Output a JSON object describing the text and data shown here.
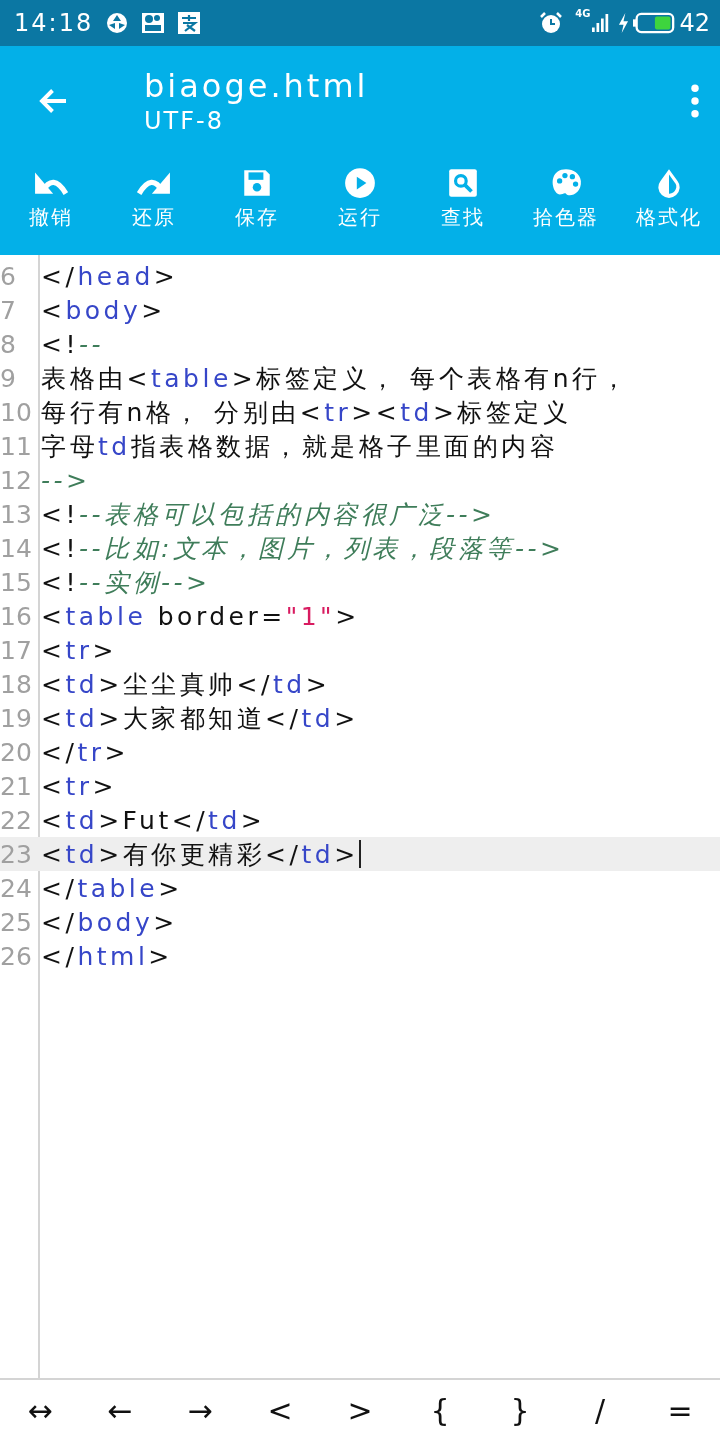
{
  "status_bar": {
    "time": "14:18",
    "network": "4G",
    "battery": "42"
  },
  "header": {
    "title": "biaoge.html",
    "subtitle": "UTF-8"
  },
  "toolbar": [
    {
      "label": "撤销"
    },
    {
      "label": "还原"
    },
    {
      "label": "保存"
    },
    {
      "label": "运行"
    },
    {
      "label": "查找"
    },
    {
      "label": "拾色器"
    },
    {
      "label": "格式化"
    }
  ],
  "editor": {
    "lines": [
      {
        "number": "6",
        "current": false,
        "tokens": [
          {
            "text": "</",
            "kind": "text"
          },
          {
            "text": "head",
            "kind": "tag"
          },
          {
            "text": ">",
            "kind": "text"
          }
        ]
      },
      {
        "number": "7",
        "current": false,
        "tokens": [
          {
            "text": "<",
            "kind": "text"
          },
          {
            "text": "body",
            "kind": "tag"
          },
          {
            "text": ">",
            "kind": "text"
          }
        ]
      },
      {
        "number": "8",
        "current": false,
        "tokens": [
          {
            "text": "<!",
            "kind": "text"
          },
          {
            "text": "--",
            "kind": "comment"
          }
        ]
      },
      {
        "number": "9",
        "current": false,
        "tokens": [
          {
            "text": "表格由<",
            "kind": "text"
          },
          {
            "text": "table",
            "kind": "tag"
          },
          {
            "text": ">标签定义， 每个表格有n行，",
            "kind": "text"
          }
        ]
      },
      {
        "number": "10",
        "current": false,
        "tokens": [
          {
            "text": "每行有n格， 分别由<",
            "kind": "text"
          },
          {
            "text": "tr",
            "kind": "tag"
          },
          {
            "text": "><",
            "kind": "text"
          },
          {
            "text": "td",
            "kind": "tag"
          },
          {
            "text": ">标签定义",
            "kind": "text"
          }
        ]
      },
      {
        "number": "11",
        "current": false,
        "tokens": [
          {
            "text": "字母",
            "kind": "text"
          },
          {
            "text": "td",
            "kind": "tag"
          },
          {
            "text": "指表格数据，就是格子里面的内容",
            "kind": "text"
          }
        ]
      },
      {
        "number": "12",
        "current": false,
        "tokens": [
          {
            "text": "-->",
            "kind": "comment"
          }
        ]
      },
      {
        "number": "13",
        "current": false,
        "tokens": [
          {
            "text": "<!",
            "kind": "text"
          },
          {
            "text": "--表格可以包括的内容很广泛-->",
            "kind": "comment"
          }
        ]
      },
      {
        "number": "14",
        "current": false,
        "tokens": [
          {
            "text": "<!",
            "kind": "text"
          },
          {
            "text": "--比如:文本，图片，列表，段落等-->",
            "kind": "comment"
          }
        ]
      },
      {
        "number": "15",
        "current": false,
        "tokens": [
          {
            "text": "<!",
            "kind": "text"
          },
          {
            "text": "--实例-->",
            "kind": "comment"
          }
        ]
      },
      {
        "number": "16",
        "current": false,
        "tokens": [
          {
            "text": "<",
            "kind": "text"
          },
          {
            "text": "table",
            "kind": "tag"
          },
          {
            "text": " border=",
            "kind": "text"
          },
          {
            "text": "\"1\"",
            "kind": "string"
          },
          {
            "text": ">",
            "kind": "text"
          }
        ]
      },
      {
        "number": "17",
        "current": false,
        "tokens": [
          {
            "text": "<",
            "kind": "text"
          },
          {
            "text": "tr",
            "kind": "tag"
          },
          {
            "text": ">",
            "kind": "text"
          }
        ]
      },
      {
        "number": "18",
        "current": false,
        "tokens": [
          {
            "text": "<",
            "kind": "text"
          },
          {
            "text": "td",
            "kind": "tag"
          },
          {
            "text": ">尘尘真帅</",
            "kind": "text"
          },
          {
            "text": "td",
            "kind": "tag"
          },
          {
            "text": ">",
            "kind": "text"
          }
        ]
      },
      {
        "number": "19",
        "current": false,
        "tokens": [
          {
            "text": "<",
            "kind": "text"
          },
          {
            "text": "td",
            "kind": "tag"
          },
          {
            "text": ">大家都知道</",
            "kind": "text"
          },
          {
            "text": "td",
            "kind": "tag"
          },
          {
            "text": ">",
            "kind": "text"
          }
        ]
      },
      {
        "number": "20",
        "current": false,
        "tokens": [
          {
            "text": "</",
            "kind": "text"
          },
          {
            "text": "tr",
            "kind": "tag"
          },
          {
            "text": ">",
            "kind": "text"
          }
        ]
      },
      {
        "number": "21",
        "current": false,
        "tokens": [
          {
            "text": "<",
            "kind": "text"
          },
          {
            "text": "tr",
            "kind": "tag"
          },
          {
            "text": ">",
            "kind": "text"
          }
        ]
      },
      {
        "number": "22",
        "current": false,
        "tokens": [
          {
            "text": "<",
            "kind": "text"
          },
          {
            "text": "td",
            "kind": "tag"
          },
          {
            "text": ">Fut</",
            "kind": "text"
          },
          {
            "text": "td",
            "kind": "tag"
          },
          {
            "text": ">",
            "kind": "text"
          }
        ]
      },
      {
        "number": "23",
        "current": true,
        "tokens": [
          {
            "text": "<",
            "kind": "text"
          },
          {
            "text": "td",
            "kind": "tag"
          },
          {
            "text": ">有你更精彩</",
            "kind": "text"
          },
          {
            "text": "td",
            "kind": "tag"
          },
          {
            "text": ">",
            "kind": "text"
          }
        ]
      },
      {
        "number": "24",
        "current": false,
        "tokens": [
          {
            "text": "</",
            "kind": "text"
          },
          {
            "text": "table",
            "kind": "tag"
          },
          {
            "text": ">",
            "kind": "text"
          }
        ]
      },
      {
        "number": "25",
        "current": false,
        "tokens": [
          {
            "text": "</",
            "kind": "text"
          },
          {
            "text": "body",
            "kind": "tag"
          },
          {
            "text": ">",
            "kind": "text"
          }
        ]
      },
      {
        "number": "26",
        "current": false,
        "tokens": [
          {
            "text": "</",
            "kind": "text"
          },
          {
            "text": "html",
            "kind": "tag"
          },
          {
            "text": ">",
            "kind": "text"
          }
        ]
      }
    ]
  },
  "keys": [
    "↔",
    "←",
    "→",
    "<",
    ">",
    "{",
    "}",
    "/",
    "="
  ]
}
